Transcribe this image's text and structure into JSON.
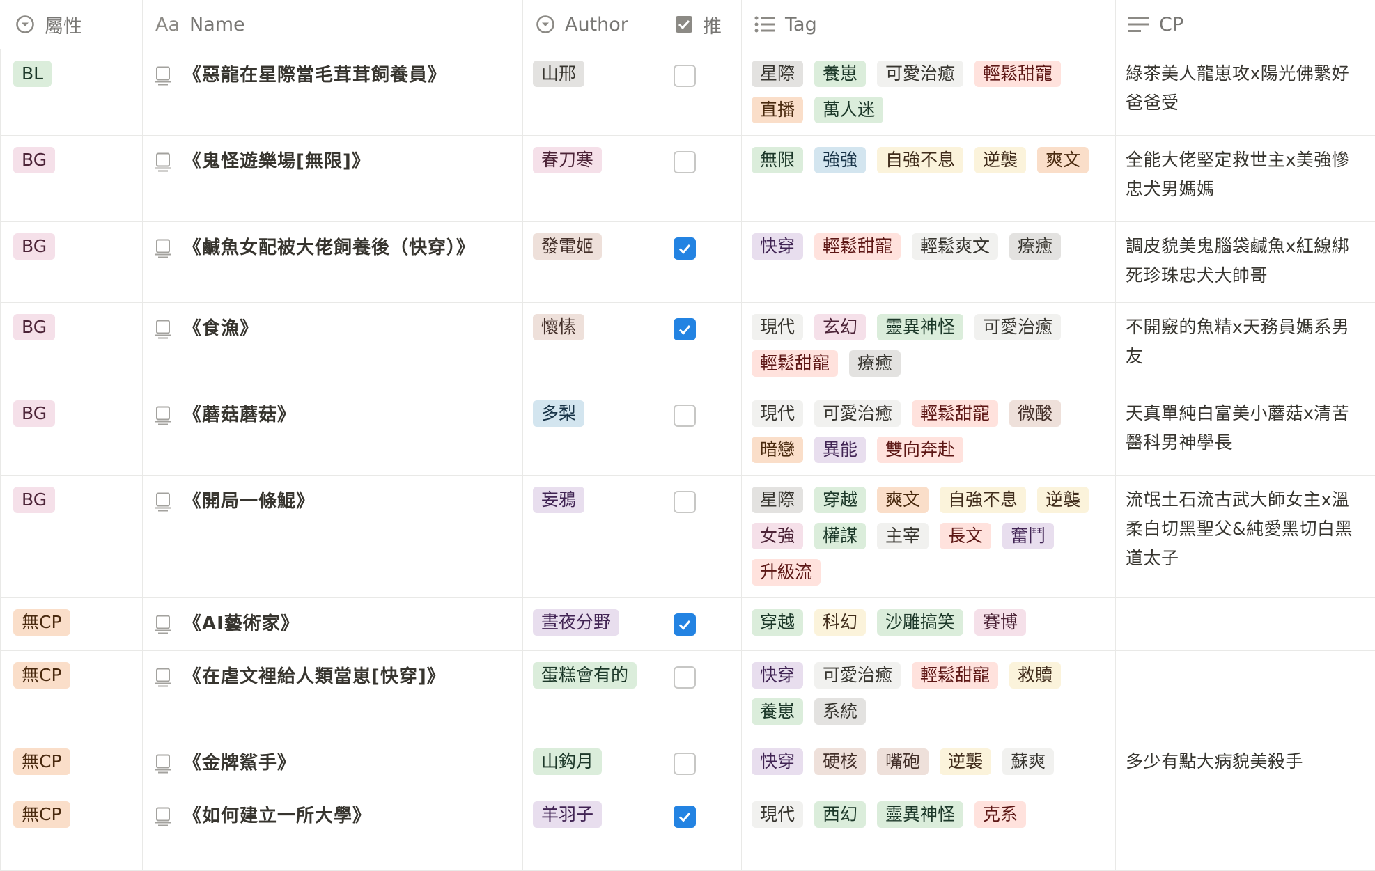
{
  "columns": {
    "attr": "屬性",
    "name": "Name",
    "name_icon": "Aa",
    "author": "Author",
    "rec": "推",
    "tag": "Tag",
    "cp": "CP"
  },
  "rows": [
    {
      "attr": "BL",
      "attr_color": "green",
      "name": "《惡龍在星際當毛茸茸飼養員》",
      "author": "山邢",
      "author_color": "gray",
      "rec": false,
      "tags": [
        [
          "星際",
          "gray"
        ],
        [
          "養崽",
          "green"
        ],
        [
          "可愛治癒",
          "lightgray"
        ],
        [
          "輕鬆甜寵",
          "red"
        ],
        [
          "直播",
          "orange"
        ],
        [
          "萬人迷",
          "green"
        ]
      ],
      "cp": "綠茶美人龍崽攻x陽光佛繫好爸爸受"
    },
    {
      "attr": "BG",
      "attr_color": "pink",
      "name": "《鬼怪遊樂場[無限]》",
      "author": "春刀寒",
      "author_color": "pink",
      "rec": false,
      "tags": [
        [
          "無限",
          "green"
        ],
        [
          "強強",
          "blue"
        ],
        [
          "自強不息",
          "yellow"
        ],
        [
          "逆襲",
          "yellow"
        ],
        [
          "爽文",
          "orange"
        ]
      ],
      "cp": "全能大佬堅定救世主x美強慘忠犬男媽媽"
    },
    {
      "attr": "BG",
      "attr_color": "pink",
      "name": "《鹹魚女配被大佬飼養後（快穿）》",
      "author": "發電姬",
      "author_color": "brown",
      "rec": true,
      "tags": [
        [
          "快穿",
          "purple"
        ],
        [
          "輕鬆甜寵",
          "red"
        ],
        [
          "輕鬆爽文",
          "lightgray"
        ],
        [
          "療癒",
          "gray"
        ]
      ],
      "cp": "調皮貌美鬼腦袋鹹魚x紅線綁死珍珠忠犬大帥哥"
    },
    {
      "attr": "BG",
      "attr_color": "pink",
      "name": "《食漁》",
      "author": "懷愫",
      "author_color": "brown",
      "rec": true,
      "tags": [
        [
          "現代",
          "lightgray"
        ],
        [
          "玄幻",
          "pink"
        ],
        [
          "靈異神怪",
          "green"
        ],
        [
          "可愛治癒",
          "lightgray"
        ],
        [
          "輕鬆甜寵",
          "red"
        ],
        [
          "療癒",
          "gray"
        ]
      ],
      "cp": "不開竅的魚精x天務員媽系男友"
    },
    {
      "attr": "BG",
      "attr_color": "pink",
      "name": "《蘑菇蘑菇》",
      "author": "多梨",
      "author_color": "blue",
      "rec": false,
      "tags": [
        [
          "現代",
          "lightgray"
        ],
        [
          "可愛治癒",
          "lightgray"
        ],
        [
          "輕鬆甜寵",
          "red"
        ],
        [
          "微酸",
          "brown"
        ],
        [
          "暗戀",
          "orange"
        ],
        [
          "異能",
          "purple"
        ],
        [
          "雙向奔赴",
          "red"
        ]
      ],
      "cp": "天真單純白富美小蘑菇x清苦醫科男神學長"
    },
    {
      "attr": "BG",
      "attr_color": "pink",
      "name": "《開局一條鯤》",
      "author": "妄鴉",
      "author_color": "purple",
      "rec": false,
      "tags": [
        [
          "星際",
          "gray"
        ],
        [
          "穿越",
          "green"
        ],
        [
          "爽文",
          "orange"
        ],
        [
          "自強不息",
          "yellow"
        ],
        [
          "逆襲",
          "yellow"
        ],
        [
          "女強",
          "pink"
        ],
        [
          "權謀",
          "green"
        ],
        [
          "主宰",
          "lightgray"
        ],
        [
          "長文",
          "red"
        ],
        [
          "奮鬥",
          "purple"
        ],
        [
          "升級流",
          "red"
        ]
      ],
      "cp": "流氓土石流古武大師女主x溫柔白切黑聖父&純愛黑切白黑道太子"
    },
    {
      "attr": "無CP",
      "attr_color": "orange",
      "name": "《AI藝術家》",
      "author": "晝夜分野",
      "author_color": "purple",
      "rec": true,
      "tags": [
        [
          "穿越",
          "green"
        ],
        [
          "科幻",
          "yellow"
        ],
        [
          "沙雕搞笑",
          "green"
        ],
        [
          "賽博",
          "pink"
        ]
      ],
      "cp": ""
    },
    {
      "attr": "無CP",
      "attr_color": "orange",
      "name": "《在虐文裡給人類當崽[快穿]》",
      "author": "蛋糕會有的",
      "author_color": "green",
      "rec": false,
      "tags": [
        [
          "快穿",
          "purple"
        ],
        [
          "可愛治癒",
          "lightgray"
        ],
        [
          "輕鬆甜寵",
          "red"
        ],
        [
          "救贖",
          "yellow"
        ],
        [
          "養崽",
          "green"
        ],
        [
          "系統",
          "gray"
        ]
      ],
      "cp": ""
    },
    {
      "attr": "無CP",
      "attr_color": "orange",
      "name": "《金牌鯊手》",
      "author": "山鈎月",
      "author_color": "green",
      "rec": false,
      "tags": [
        [
          "快穿",
          "purple"
        ],
        [
          "硬核",
          "brown"
        ],
        [
          "嘴砲",
          "brown"
        ],
        [
          "逆襲",
          "yellow"
        ],
        [
          "蘇爽",
          "lightgray"
        ]
      ],
      "cp": "多少有點大病貌美殺手"
    },
    {
      "attr": "無CP",
      "attr_color": "orange",
      "name": "《如何建立一所大學》",
      "author": "羊羽子",
      "author_color": "purple",
      "rec": true,
      "tags": [
        [
          "現代",
          "lightgray"
        ],
        [
          "西幻",
          "green"
        ],
        [
          "靈異神怪",
          "green"
        ],
        [
          "克系",
          "red"
        ]
      ],
      "cp": ""
    }
  ]
}
